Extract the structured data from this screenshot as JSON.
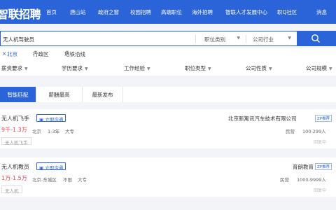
{
  "nav": {
    "logo": "智联招聘",
    "items": [
      "首页",
      "唐山站",
      "政府之窗",
      "校园招聘",
      "高端职位",
      "海外招聘",
      "智联人才发展中心",
      "职Q社区"
    ],
    "messages": "消息"
  },
  "search": {
    "keyword": "无人机驾驶员",
    "job_category": "职位类别",
    "industry": "公司行业"
  },
  "filters": {
    "location": {
      "city": "北京",
      "district": "行政区",
      "subway": "地铁沿线"
    },
    "requirements": [
      "薪资要求",
      "学历要求",
      "工作经验",
      "职位类型",
      "公司性质",
      "公司规模"
    ]
  },
  "tabs": [
    "智能匹配",
    "薪酬最高",
    "最新发布"
  ],
  "chat_label": "立即沟通",
  "jobs": [
    {
      "title": "无人机飞手",
      "salary": "9千-1.3万",
      "location": "北京",
      "experience": "1-3年",
      "education": "大专",
      "tag": "无人机飞手",
      "company": "北京新篱讯汽车技术有限公司",
      "badge": "ZP推荐",
      "company_type": "民营",
      "company_size": "100-299人",
      "reply": "回复中"
    },
    {
      "title": "无人机教员",
      "salary": "1万-1.5万",
      "location": "北京-东城区",
      "experience": "不限",
      "education": "大专",
      "tag": "无人机",
      "company": "育朗教育",
      "badge": "ZP推荐",
      "company_type": "民营",
      "company_size": "1000-9999人",
      "reply": "回复中"
    }
  ],
  "colors": {
    "primary": "#2b64d8",
    "salary": "#f5414d"
  }
}
